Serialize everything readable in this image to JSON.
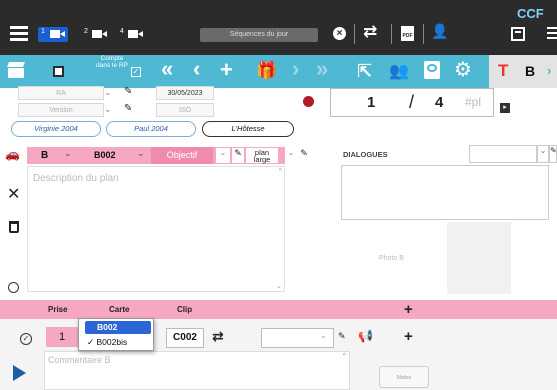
{
  "topbar": {
    "brand": "CCF",
    "sequence_placeholder": "Séquences du jour",
    "cam_labels": [
      "1",
      "2",
      "4"
    ]
  },
  "toolbar": {
    "compte_label": "Compte dans le RP"
  },
  "form": {
    "field_left_1": "RA",
    "field_left_2": "Version",
    "date": "30/05/2023",
    "iso": "ISO",
    "pills": [
      "Virginie 2004",
      "Paul 2004",
      "L'Hôtesse"
    ],
    "counter_current": "1",
    "counter_sep": "/",
    "counter_total": "4",
    "counter_unit": "#pl",
    "plan_letter": "B",
    "plan_code": "B002",
    "objectif": "Objectif",
    "plan_type": "plan large",
    "description_placeholder": "Description du plan",
    "dialogues_label": "DIALOGUES",
    "photo_label": "Photo B"
  },
  "prise": {
    "headers": {
      "prise": "Prise",
      "carte": "Carte",
      "clip": "Clip"
    },
    "prise_value": "1",
    "clip_value": "C002",
    "comment_placeholder": "Commentaire B",
    "small_button": "Notes",
    "dropdown_options": [
      "B002",
      "B002bis"
    ],
    "dropdown_selected": "B002bis",
    "dropdown_highlighted": "B002"
  },
  "colors": {
    "teal": "#4fb8d3",
    "pink": "#f5a7c4",
    "dark": "#2b2b2b",
    "highlight": "#2b66d6",
    "record_dot": "#b01c24"
  }
}
